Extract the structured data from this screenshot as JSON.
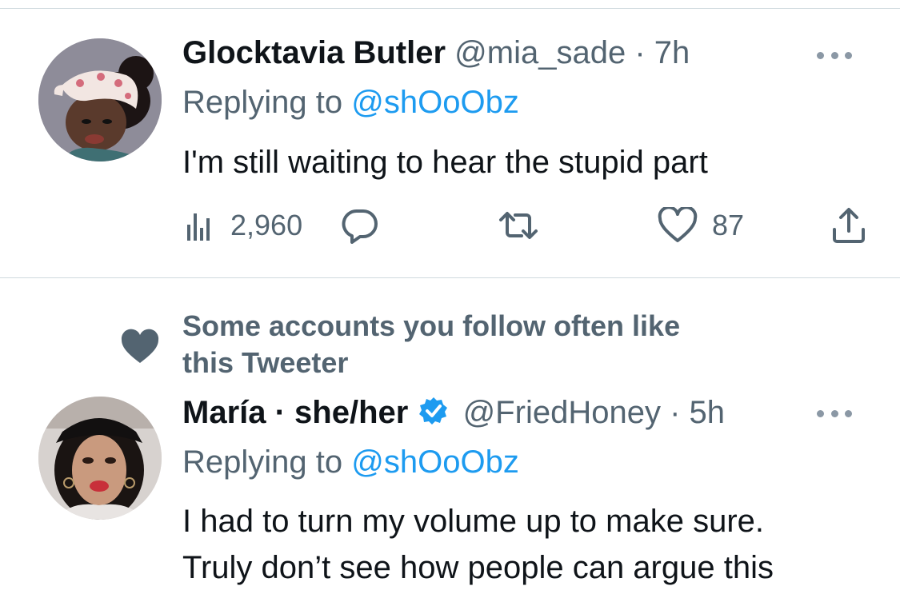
{
  "tweets": [
    {
      "name": "Glocktavia Butler",
      "handle": "@mia_sade",
      "separator": "·",
      "time": "7h",
      "replying_prefix": "Replying to",
      "replying_handle": "@shOoObz",
      "text": "I'm still waiting to hear the stupid part",
      "views": "2,960",
      "likes": "87",
      "verified": false
    },
    {
      "name": "María · she/her",
      "handle": "@FriedHoney",
      "separator": "·",
      "time": "5h",
      "replying_prefix": "Replying to",
      "replying_handle": "@shOoObz",
      "text_lines": [
        "I had to turn my volume up to make sure.",
        "Truly don’t see how people can argue this"
      ],
      "verified": true
    }
  ],
  "social_context": {
    "icon": "heart-icon",
    "text_line1": "Some accounts you follow often like",
    "text_line2": "this Tweeter"
  },
  "colors": {
    "text_primary": "#0f1419",
    "text_secondary": "#536471",
    "link": "#1d9bf0",
    "divider": "#cfd9de",
    "verified": "#1d9bf0"
  }
}
